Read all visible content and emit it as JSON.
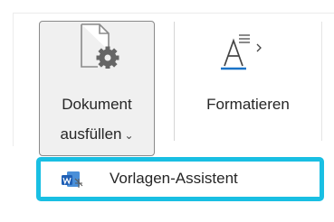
{
  "ribbon": {
    "buttons": [
      {
        "label_line1": "Dokument",
        "label_line2": "ausfüllen",
        "dropdown": "chevron-down"
      },
      {
        "label": "Formatieren",
        "icon": "format-text-icon"
      }
    ]
  },
  "dropdown_menu": {
    "items": [
      {
        "label": "Vorlagen-Assistent",
        "icon": "word-template-wizard-icon"
      }
    ],
    "highlight_color": "#19bfe3"
  },
  "glyphs": {
    "chevron_down": "⌄"
  }
}
